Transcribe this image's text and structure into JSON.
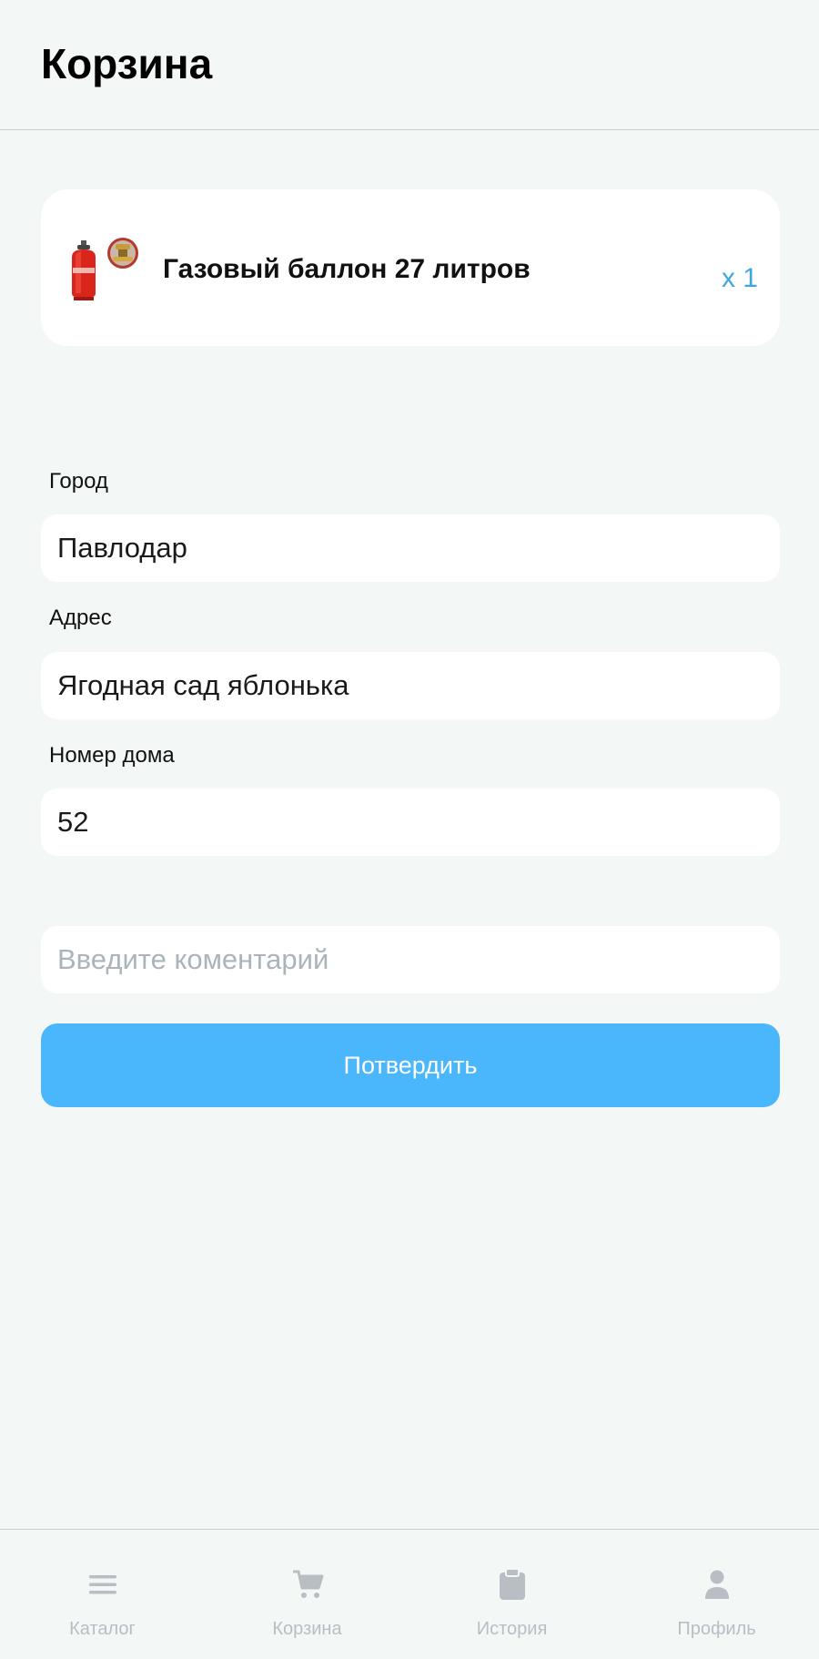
{
  "header": {
    "title": "Корзина"
  },
  "cart": {
    "items": [
      {
        "name": "Газовый баллон 27 литров",
        "quantity": "x 1",
        "image": "gas-cylinder-image"
      }
    ]
  },
  "form": {
    "city": {
      "label": "Город",
      "value": "Павлодар"
    },
    "address": {
      "label": "Адрес",
      "value": "Ягодная сад яблонька"
    },
    "house_number": {
      "label": "Номер дома",
      "value": "52"
    },
    "comment": {
      "placeholder": "Введите коментарий",
      "value": ""
    },
    "confirm_label": "Потвердить"
  },
  "bottom_nav": {
    "items": [
      {
        "label": "Каталог",
        "icon": "menu-icon"
      },
      {
        "label": "Корзина",
        "icon": "cart-icon"
      },
      {
        "label": "История",
        "icon": "clipboard-icon"
      },
      {
        "label": "Профиль",
        "icon": "person-icon"
      }
    ]
  },
  "colors": {
    "background": "#f3f8f7",
    "accent": "#4ab6fb",
    "quantity": "#3fa7e0",
    "nav_inactive": "#b8bec3"
  }
}
